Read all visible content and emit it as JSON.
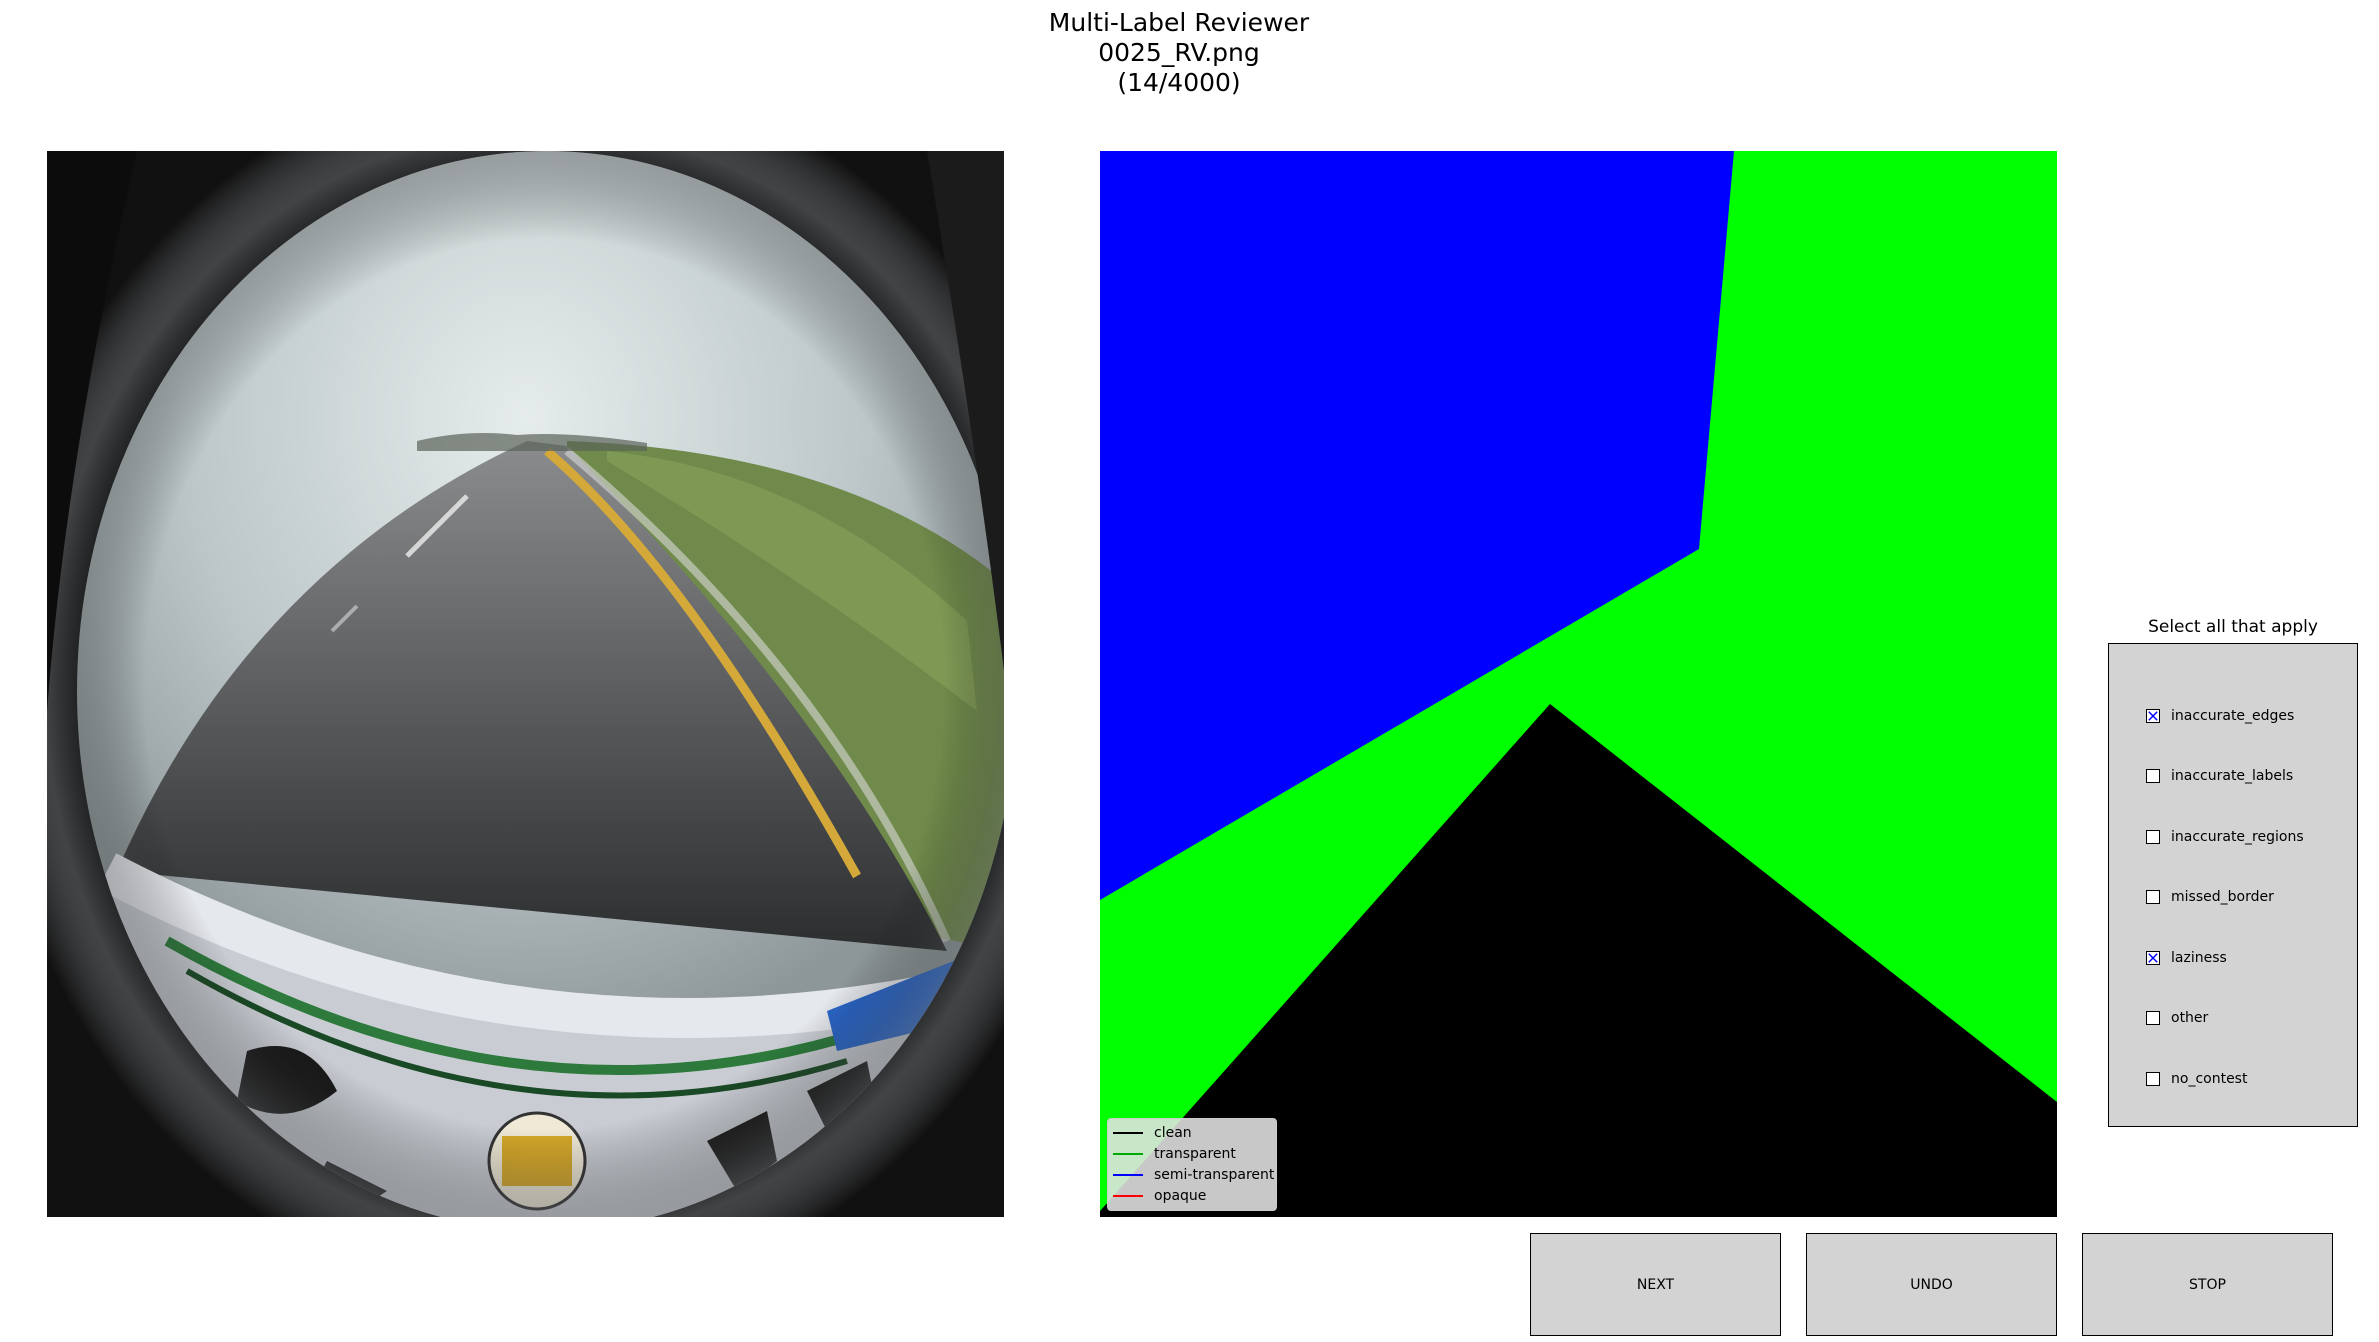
{
  "header": {
    "title": "Multi-Label Reviewer",
    "filename": "0025_RV.png",
    "progress": "(14/4000)"
  },
  "legend": {
    "items": [
      {
        "label": "clean",
        "color": "#000000"
      },
      {
        "label": "transparent",
        "color": "#00aa00"
      },
      {
        "label": "semi-transparent",
        "color": "#0000ff"
      },
      {
        "label": "opaque",
        "color": "#ff0000"
      }
    ]
  },
  "mask_colors": {
    "clean": "#000000",
    "transparent": "#00ff00",
    "semi_transparent": "#0000ff"
  },
  "checklist": {
    "title": "Select all that apply",
    "options": [
      {
        "label": "inaccurate_edges",
        "checked": true
      },
      {
        "label": "inaccurate_labels",
        "checked": false
      },
      {
        "label": "inaccurate_regions",
        "checked": false
      },
      {
        "label": "missed_border",
        "checked": false
      },
      {
        "label": "laziness",
        "checked": true
      },
      {
        "label": "other",
        "checked": false
      },
      {
        "label": "no_contest",
        "checked": false
      }
    ]
  },
  "buttons": {
    "next": "NEXT",
    "undo": "UNDO",
    "stop": "STOP"
  }
}
